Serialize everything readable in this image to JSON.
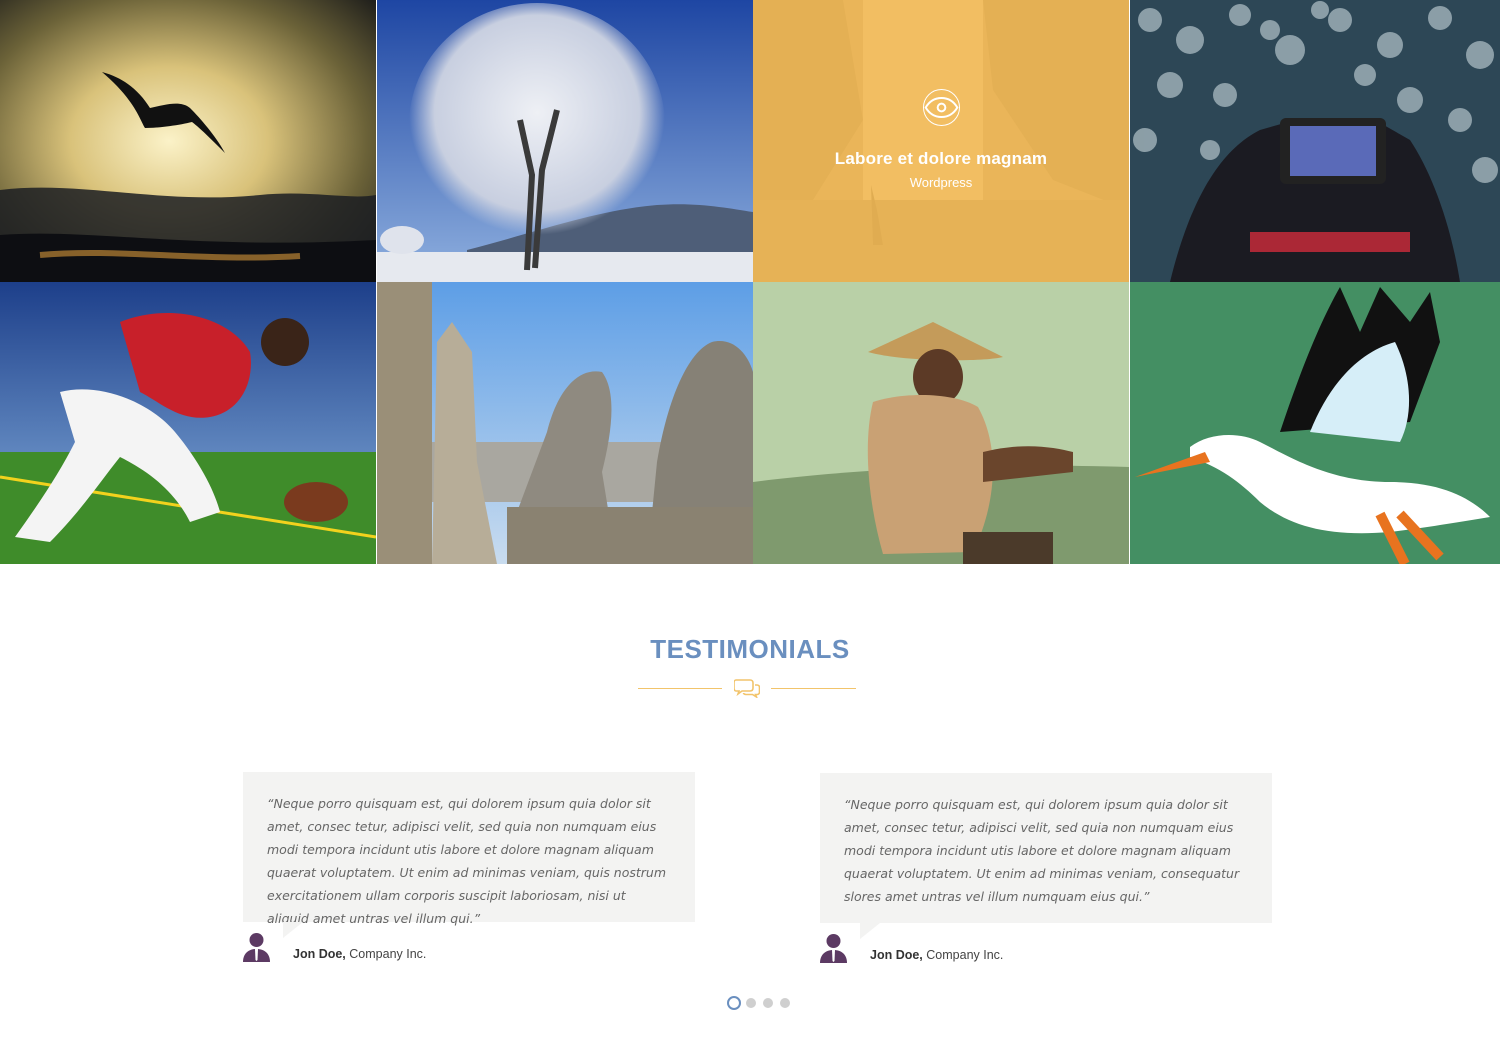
{
  "portfolio": {
    "tiles": [
      {
        "subject": "bird-sunset"
      },
      {
        "subject": "frosted-tree"
      },
      {
        "subject": "waterfall-hiker",
        "overlay": {
          "title": "Labore et dolore magnam",
          "category": "Wordpress",
          "icon": "eye-icon"
        }
      },
      {
        "subject": "camera-bokeh"
      },
      {
        "subject": "football-player"
      },
      {
        "subject": "gargoyle-paris"
      },
      {
        "subject": "man-conical-hat"
      },
      {
        "subject": "stork-illustration"
      }
    ],
    "overlay_color": "#f7bd57"
  },
  "testimonials": {
    "title": "TESTIMONIALS",
    "accent_color": "#6a8fbf",
    "divider_color": "#f2c46b",
    "divider_icon": "chat-bubbles-icon",
    "items": [
      {
        "quote": "“Neque porro quisquam est, qui dolorem ipsum quia dolor sit amet, consec tetur, adipisci velit, sed quia non numquam eius modi tempora incidunt utis labore et dolore magnam aliquam quaerat voluptatem. Ut enim ad minimas veniam, quis nostrum exercitationem ullam corporis suscipit laboriosam, nisi ut aliquid amet untras vel illum qui.”",
        "name": "Jon Doe,",
        "company": " Company Inc."
      },
      {
        "quote": "“Neque porro quisquam est, qui dolorem ipsum quia dolor sit amet, consec tetur, adipisci velit, sed quia non numquam eius modi tempora incidunt utis labore et dolore magnam aliquam quaerat voluptatem. Ut enim ad minimas veniam, consequatur slores amet untras vel illum numquam eius qui.”",
        "name": "Jon Doe,",
        "company": " Company Inc."
      }
    ],
    "pagination": {
      "total": 4,
      "active": 1
    }
  }
}
